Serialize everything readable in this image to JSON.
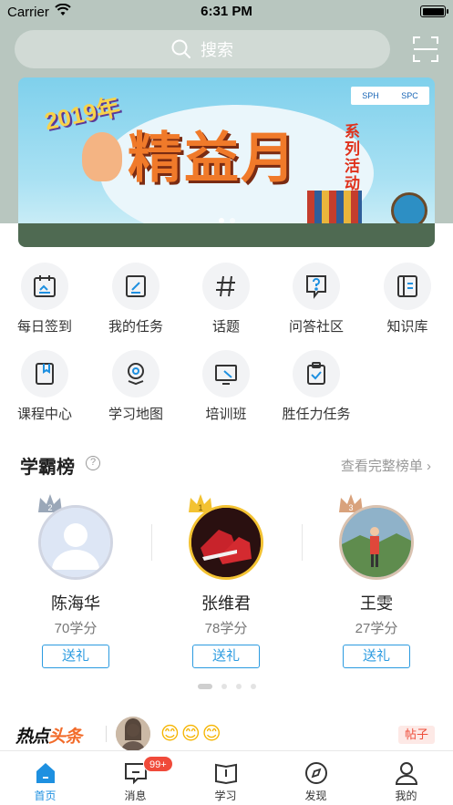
{
  "status_bar": {
    "carrier": "Carrier",
    "time": "6:31 PM"
  },
  "search": {
    "placeholder": "搜索"
  },
  "banner": {
    "year": "2019年",
    "title": "精益月",
    "series": "系列活动",
    "logo_left": "SPH",
    "logo_right": "SPC"
  },
  "grid": [
    {
      "label": "每日签到",
      "icon": "calendar-check-icon"
    },
    {
      "label": "我的任务",
      "icon": "task-edit-icon"
    },
    {
      "label": "话题",
      "icon": "hashtag-icon"
    },
    {
      "label": "问答社区",
      "icon": "question-bubble-icon"
    },
    {
      "label": "知识库",
      "icon": "book-list-icon"
    },
    {
      "label": "课程中心",
      "icon": "course-book-icon"
    },
    {
      "label": "学习地图",
      "icon": "map-pin-icon"
    },
    {
      "label": "培训班",
      "icon": "screen-pen-icon"
    },
    {
      "label": "胜任力任务",
      "icon": "clipboard-check-icon"
    }
  ],
  "leaderboard": {
    "title": "学霸榜",
    "help": "?",
    "more": "查看完整榜单",
    "entries": [
      {
        "rank": "2",
        "name": "陈海华",
        "score": "70学分",
        "gift": "送礼",
        "crown_color": "#9aa7b8"
      },
      {
        "rank": "1",
        "name": "张维君",
        "score": "78学分",
        "gift": "送礼",
        "crown_color": "#f3c232"
      },
      {
        "rank": "3",
        "name": "王雯",
        "score": "27学分",
        "gift": "送礼",
        "crown_color": "#d9a27c"
      }
    ]
  },
  "news": {
    "brand_a": "热点",
    "brand_b": "头条",
    "emojis": "😊😊😊",
    "tag": "帖子"
  },
  "tabbar": [
    {
      "label": "首页",
      "active": true
    },
    {
      "label": "消息",
      "badge": "99+"
    },
    {
      "label": "学习"
    },
    {
      "label": "发现"
    },
    {
      "label": "我的"
    }
  ],
  "colors": {
    "accent": "#1e90e0",
    "badge": "#f04a3a",
    "gold": "#f3c232"
  }
}
